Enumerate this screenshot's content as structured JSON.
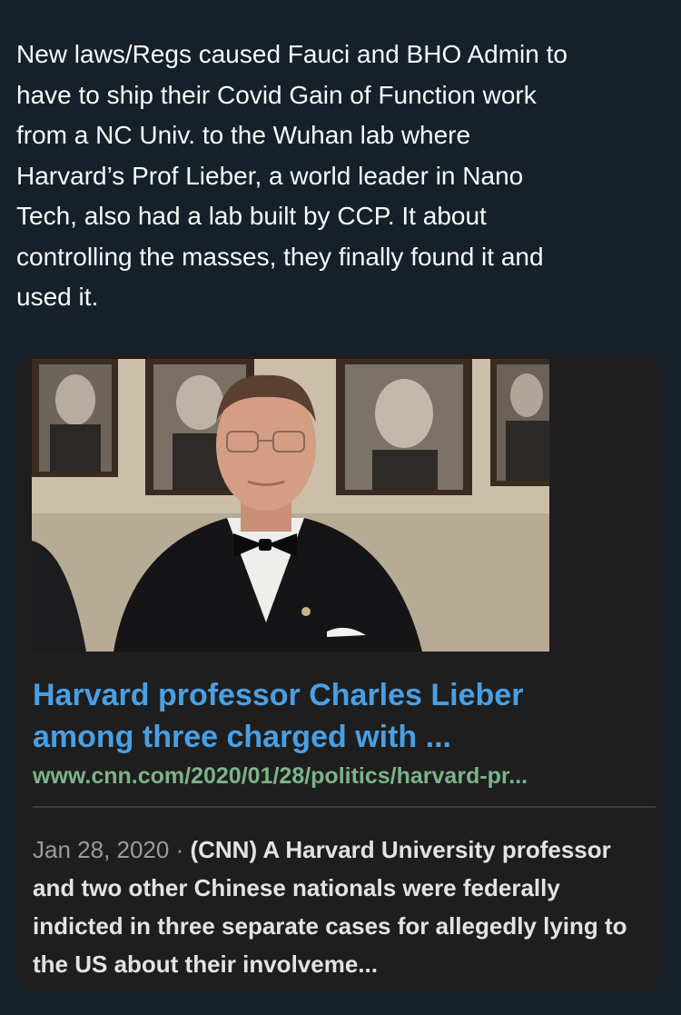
{
  "tweet": {
    "text": "New laws/Regs caused Fauci and BHO Admin to\nhave to ship their Covid Gain of Function work\nfrom a NC Univ. to the Wuhan lab where\nHarvard’s Prof Lieber, a world leader in Nano\nTech, also had a lab built by CCP. It about\ncontrolling the masses, they finally found it and\nused it."
  },
  "card": {
    "image": "photo-of-man-in-tuxedo-bow-tie",
    "title": "Harvard professor Charles Lieber\namong three charged with ...",
    "url": "www.cnn.com/2020/01/28/politics/harvard-pr...",
    "date": "Jan 28, 2020",
    "separator": " · ",
    "snippet": "(CNN) A Harvard University professor and two other Chinese nationals were federally indicted in three separate cases for allegedly lying to the US about their involveme..."
  },
  "colors": {
    "background": "#15202b",
    "card_background": "#1e1e1f",
    "title_link": "#4a9fe3",
    "url_text": "#7cb38a"
  }
}
